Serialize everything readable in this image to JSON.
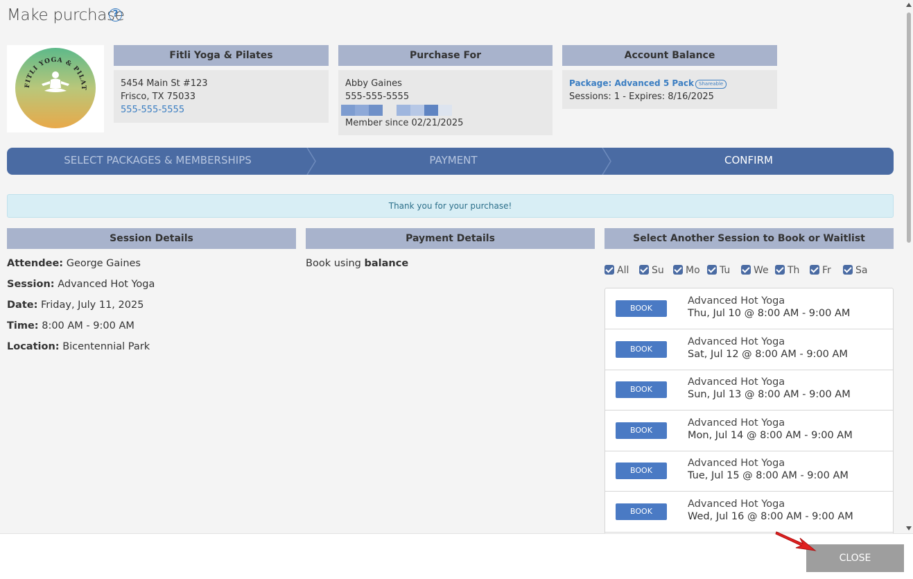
{
  "title": "Make purchase",
  "help_icon": "?",
  "studio": {
    "name": "Fitli Yoga & Pilates",
    "logo_text": "FITLI YOGA & PILATES",
    "address1": "5454 Main St #123",
    "address2": "Frisco, TX 75033",
    "phone": "555-555-5555"
  },
  "purchase_for": {
    "heading": "Purchase For",
    "name": "Abby Gaines",
    "phone": "555-555-5555",
    "member_since": "Member since 02/21/2025"
  },
  "account_balance": {
    "heading": "Account Balance",
    "package": "Package: Advanced 5 Pack",
    "badge": "Shareable",
    "sessions": "Sessions: 1 -  Expires: 8/16/2025"
  },
  "steps": [
    {
      "label": "SELECT PACKAGES & MEMBERSHIPS",
      "active": false
    },
    {
      "label": "PAYMENT",
      "active": false
    },
    {
      "label": "CONFIRM",
      "active": true
    }
  ],
  "alert": "Thank you for your purchase!",
  "session_details": {
    "heading": "Session Details",
    "attendee_label": "Attendee:",
    "attendee": "George Gaines",
    "session_label": "Session:",
    "session": "Advanced Hot Yoga",
    "date_label": "Date:",
    "date": "Friday, July 11, 2025",
    "time_label": "Time:",
    "time": "8:00 AM - 9:00 AM",
    "location_label": "Location:",
    "location": "Bicentennial Park"
  },
  "payment_details": {
    "heading": "Payment Details",
    "text": "Book using",
    "method": "balance"
  },
  "another_session": {
    "heading": "Select Another Session to Book or Waitlist",
    "days": [
      "All",
      "Su",
      "Mo",
      "Tu",
      "We",
      "Th",
      "Fr",
      "Sa"
    ],
    "book_label": "BOOK",
    "sessions": [
      {
        "title": "Advanced Hot Yoga",
        "when": "Thu, Jul 10 @ 8:00 AM - 9:00 AM"
      },
      {
        "title": "Advanced Hot Yoga",
        "when": "Sat, Jul 12 @ 8:00 AM - 9:00 AM"
      },
      {
        "title": "Advanced Hot Yoga",
        "when": "Sun, Jul 13 @ 8:00 AM - 9:00 AM"
      },
      {
        "title": "Advanced Hot Yoga",
        "when": "Mon, Jul 14 @ 8:00 AM - 9:00 AM"
      },
      {
        "title": "Advanced Hot Yoga",
        "when": "Tue, Jul 15 @ 8:00 AM - 9:00 AM"
      },
      {
        "title": "Advanced Hot Yoga",
        "when": "Wed, Jul 16 @ 8:00 AM - 9:00 AM"
      }
    ]
  },
  "footer": {
    "close_label": "CLOSE"
  },
  "colors": {
    "header_bg": "#a8b3cc",
    "step_bg": "#4a6ba3",
    "book_btn": "#4a7ac4",
    "link": "#3b7ec2",
    "close_btn": "#9e9e9e",
    "annotation_arrow": "#e02020"
  }
}
